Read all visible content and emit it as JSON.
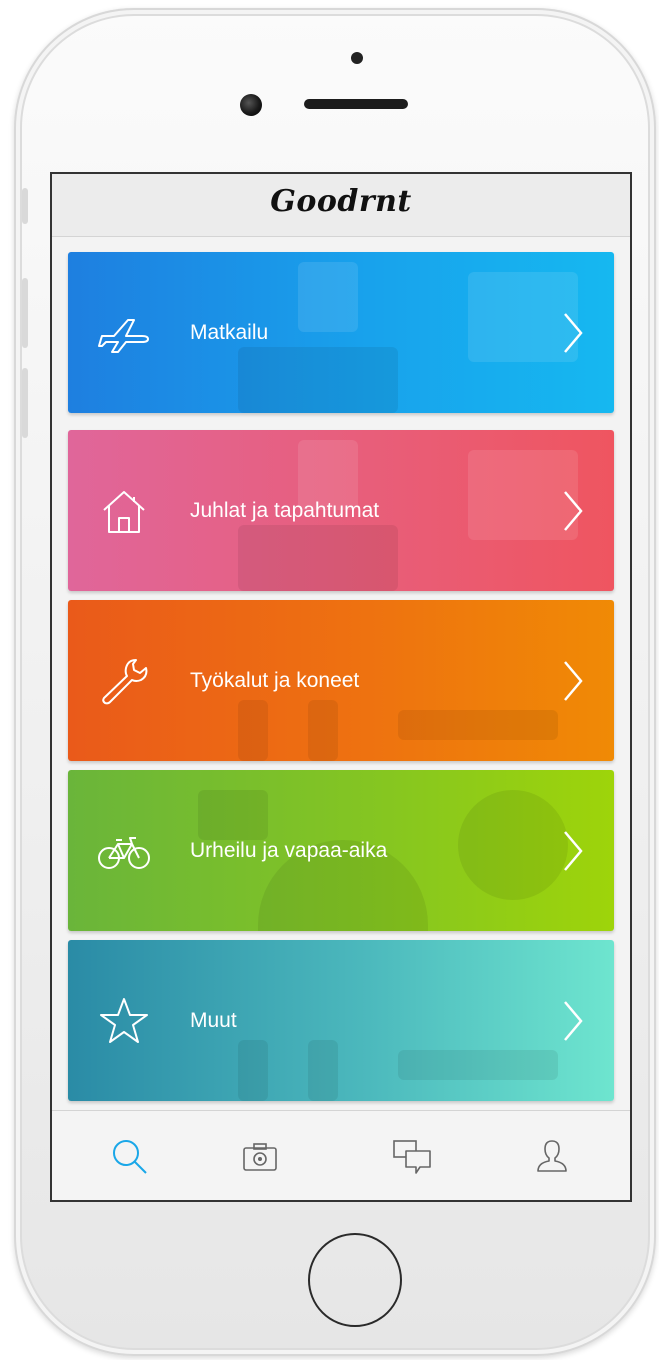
{
  "app": {
    "title": "Goodrnt"
  },
  "categories": [
    {
      "label": "Matkailu",
      "icon": "airplane-icon"
    },
    {
      "label": "Juhlat ja tapahtumat",
      "icon": "house-icon"
    },
    {
      "label": "Työkalut ja koneet",
      "icon": "wrench-icon"
    },
    {
      "label": "Urheilu ja vapaa-aika",
      "icon": "bicycle-icon"
    },
    {
      "label": "Muut",
      "icon": "star-icon"
    }
  ],
  "tabs": [
    {
      "icon": "search-icon",
      "active": true
    },
    {
      "icon": "camera-icon",
      "active": false
    },
    {
      "icon": "chat-icon",
      "active": false
    },
    {
      "icon": "profile-icon",
      "active": false
    }
  ],
  "colors": {
    "accent": "#1aa7e8",
    "matkailu": [
      "#1e7fe0",
      "#16b8f0"
    ],
    "juhlat": [
      "#e0669a",
      "#ef5560"
    ],
    "tyokalut": [
      "#ea5a1a",
      "#f08a05"
    ],
    "urheilu": [
      "#6ab53a",
      "#9ed40a"
    ],
    "muut": [
      "#2a8ba6",
      "#6ee5cf"
    ]
  }
}
